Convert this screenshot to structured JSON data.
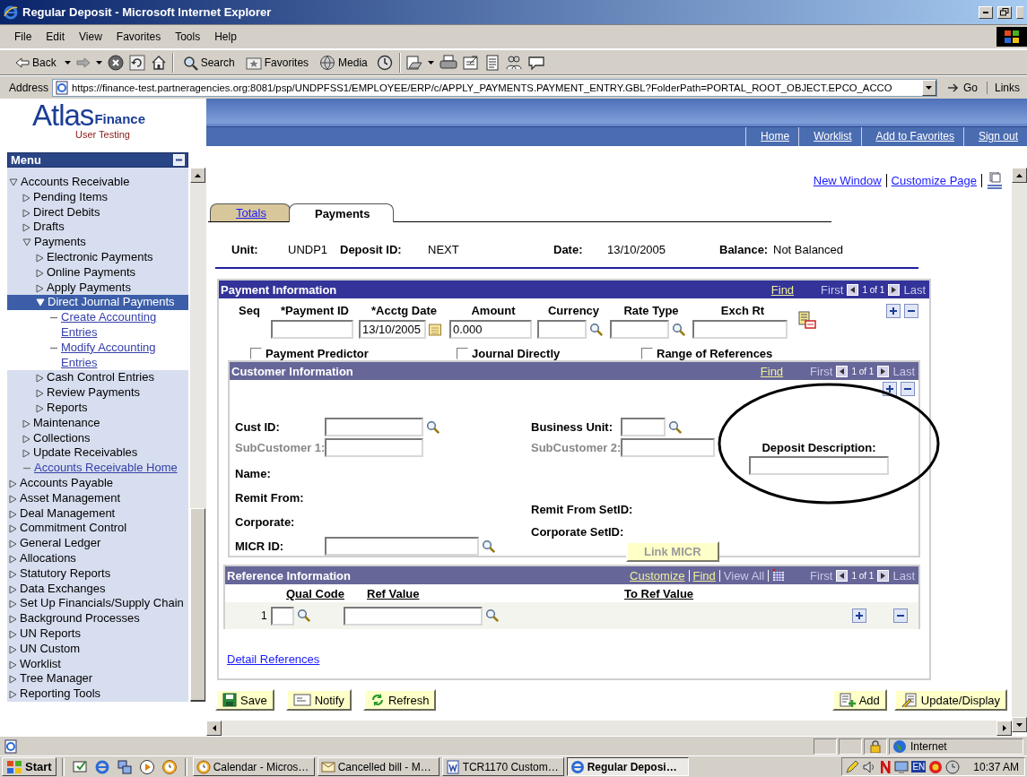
{
  "window": {
    "title": "Regular Deposit - Microsoft Internet Explorer"
  },
  "menu_bar": [
    "File",
    "Edit",
    "View",
    "Favorites",
    "Tools",
    "Help"
  ],
  "toolbar": {
    "back": "Back",
    "search": "Search",
    "favorites": "Favorites",
    "media": "Media"
  },
  "address_bar": {
    "label": "Address",
    "url": "https://finance-test.partneragencies.org:8081/psp/UNDPFSS1/EMPLOYEE/ERP/c/APPLY_PAYMENTS.PAYMENT_ENTRY.GBL?FolderPath=PORTAL_ROOT_OBJECT.EPCO_ACCO",
    "go": "Go",
    "links": "Links"
  },
  "header": {
    "logo": "Atlas",
    "logo_product": "Finance",
    "logo_tagline": "User Testing",
    "links": [
      "Home",
      "Worklist",
      "Add to Favorites",
      "Sign out"
    ]
  },
  "menu": {
    "title": "Menu",
    "items": [
      {
        "label": "Accounts Receivable",
        "kind": "folder",
        "expanded": true,
        "selected": false,
        "children": [
          {
            "label": "Pending Items",
            "kind": "folder",
            "expanded": false,
            "selected": false
          },
          {
            "label": "Direct Debits",
            "kind": "folder",
            "expanded": false,
            "selected": false
          },
          {
            "label": "Drafts",
            "kind": "folder",
            "expanded": false,
            "selected": false
          },
          {
            "label": "Payments",
            "kind": "folder",
            "expanded": true,
            "selected": false,
            "children": [
              {
                "label": "Electronic Payments",
                "kind": "folder",
                "expanded": false,
                "selected": false
              },
              {
                "label": "Online Payments",
                "kind": "folder",
                "expanded": false,
                "selected": false
              },
              {
                "label": "Apply Payments",
                "kind": "folder",
                "expanded": false,
                "selected": false
              },
              {
                "label": "Direct Journal Payments",
                "kind": "folder",
                "expanded": true,
                "selected": true,
                "children": [
                  {
                    "label": "Create Accounting Entries",
                    "kind": "link",
                    "selected": false
                  },
                  {
                    "label": "Modify Accounting Entries",
                    "kind": "link",
                    "selected": false
                  }
                ]
              },
              {
                "label": "Cash Control Entries",
                "kind": "folder",
                "expanded": false,
                "selected": false
              },
              {
                "label": "Review Payments",
                "kind": "folder",
                "expanded": false,
                "selected": false
              },
              {
                "label": "Reports",
                "kind": "folder",
                "expanded": false,
                "selected": false
              }
            ]
          },
          {
            "label": "Maintenance",
            "kind": "folder",
            "expanded": false,
            "selected": false
          },
          {
            "label": "Collections",
            "kind": "folder",
            "expanded": false,
            "selected": false
          },
          {
            "label": "Update Receivables",
            "kind": "folder",
            "expanded": false,
            "selected": false
          },
          {
            "label": "Accounts Receivable Home",
            "kind": "link",
            "selected": false
          }
        ]
      },
      {
        "label": "Accounts Payable",
        "kind": "folder",
        "expanded": false,
        "selected": false
      },
      {
        "label": "Asset Management",
        "kind": "folder",
        "expanded": false,
        "selected": false
      },
      {
        "label": "Deal Management",
        "kind": "folder",
        "expanded": false,
        "selected": false
      },
      {
        "label": "Commitment Control",
        "kind": "folder",
        "expanded": false,
        "selected": false
      },
      {
        "label": "General Ledger",
        "kind": "folder",
        "expanded": false,
        "selected": false
      },
      {
        "label": "Allocations",
        "kind": "folder",
        "expanded": false,
        "selected": false
      },
      {
        "label": "Statutory Reports",
        "kind": "folder",
        "expanded": false,
        "selected": false
      },
      {
        "label": "Data Exchanges",
        "kind": "folder",
        "expanded": false,
        "selected": false
      },
      {
        "label": "Set Up Financials/Supply Chain",
        "kind": "folder",
        "expanded": false,
        "selected": false
      },
      {
        "label": "Background Processes",
        "kind": "folder",
        "expanded": false,
        "selected": false
      },
      {
        "label": "UN Reports",
        "kind": "folder",
        "expanded": false,
        "selected": false
      },
      {
        "label": "UN Custom",
        "kind": "folder",
        "expanded": false,
        "selected": false
      },
      {
        "label": "Worklist",
        "kind": "folder",
        "expanded": false,
        "selected": false
      },
      {
        "label": "Tree Manager",
        "kind": "folder",
        "expanded": false,
        "selected": false
      },
      {
        "label": "Reporting Tools",
        "kind": "folder",
        "expanded": false,
        "selected": false
      }
    ]
  },
  "page_links": [
    "New Window",
    "Customize Page"
  ],
  "tabs": [
    {
      "label": "Totals",
      "selected": false
    },
    {
      "label": "Payments",
      "selected": true
    }
  ],
  "key_fields": [
    {
      "label": "Unit:",
      "value": "UNDP1"
    },
    {
      "label": "Deposit ID:",
      "value": "NEXT"
    },
    {
      "label": "Date:",
      "value": "13/10/2005"
    },
    {
      "label": "Balance:",
      "value": "Not Balanced"
    }
  ],
  "payment_info": {
    "title": "Payment Information",
    "nav": {
      "find": "Find",
      "first": "First",
      "count": "1 of 1",
      "last": "Last"
    },
    "fields": [
      {
        "label": "Seq",
        "kind": "label"
      },
      {
        "label": "*Payment ID",
        "kind": "input"
      },
      {
        "label": "*Acctg Date",
        "kind": "date",
        "value": "13/10/2005"
      },
      {
        "label": "Amount",
        "kind": "input",
        "value": "0.000"
      },
      {
        "label": "Currency",
        "kind": "lookup"
      },
      {
        "label": "Rate Type",
        "kind": "lookup"
      },
      {
        "label": "Exch Rt",
        "kind": "input"
      }
    ],
    "checkboxes": [
      {
        "label": "Payment Predictor",
        "checked": false
      },
      {
        "label": "Journal Directly",
        "checked": false
      },
      {
        "label": "Range of References",
        "checked": false
      }
    ]
  },
  "customer_info": {
    "title": "Customer Information",
    "nav": {
      "find": "Find",
      "first": "First",
      "count": "1 of 1",
      "last": "Last"
    },
    "left": [
      {
        "label": "Cust ID:",
        "kind": "lookup",
        "disabled": false
      },
      {
        "label": "SubCustomer 1:",
        "kind": "input",
        "disabled": true
      },
      {
        "label": "Name:",
        "kind": "label",
        "disabled": false
      },
      {
        "label": "Remit From:",
        "kind": "label",
        "disabled": false
      },
      {
        "label": "Corporate:",
        "kind": "label",
        "disabled": false
      },
      {
        "label": "MICR ID:",
        "kind": "lookup",
        "disabled": false
      }
    ],
    "right": [
      {
        "label": "Business Unit:",
        "kind": "lookup",
        "disabled": false
      },
      {
        "label": "SubCustomer 2:",
        "kind": "input",
        "disabled": true
      },
      {
        "label": "Remit From SetID:",
        "kind": "label",
        "disabled": false
      },
      {
        "label": "Corporate SetID:",
        "kind": "label",
        "disabled": false
      },
      {
        "label": "Link MICR",
        "kind": "button",
        "disabled": true
      }
    ],
    "deposit_description": {
      "label": "Deposit Description:"
    }
  },
  "reference_info": {
    "title": "Reference Information",
    "nav": {
      "customize": "Customize",
      "find": "Find",
      "view_all": "View All",
      "first": "First",
      "count": "1 of 1",
      "last": "Last"
    },
    "columns": [
      "Qual Code",
      "Ref Value",
      "To Ref Value"
    ],
    "rows": [
      {
        "number": "1"
      }
    ]
  },
  "detail_link": "Detail References",
  "buttons_left": [
    "Save",
    "Notify",
    "Refresh"
  ],
  "buttons_right": [
    "Add",
    "Update/Display"
  ],
  "status_bar": {
    "zone": "Internet"
  },
  "taskbar": {
    "start": "Start",
    "tasks": [
      {
        "label": "Calendar - Micros…",
        "selected": false
      },
      {
        "label": "Cancelled bill - M…",
        "selected": false
      },
      {
        "label": "TCR1170 Custom…",
        "selected": false
      },
      {
        "label": "Regular Deposi…",
        "selected": true
      }
    ],
    "language": "EN",
    "clock": "10:37 AM"
  }
}
